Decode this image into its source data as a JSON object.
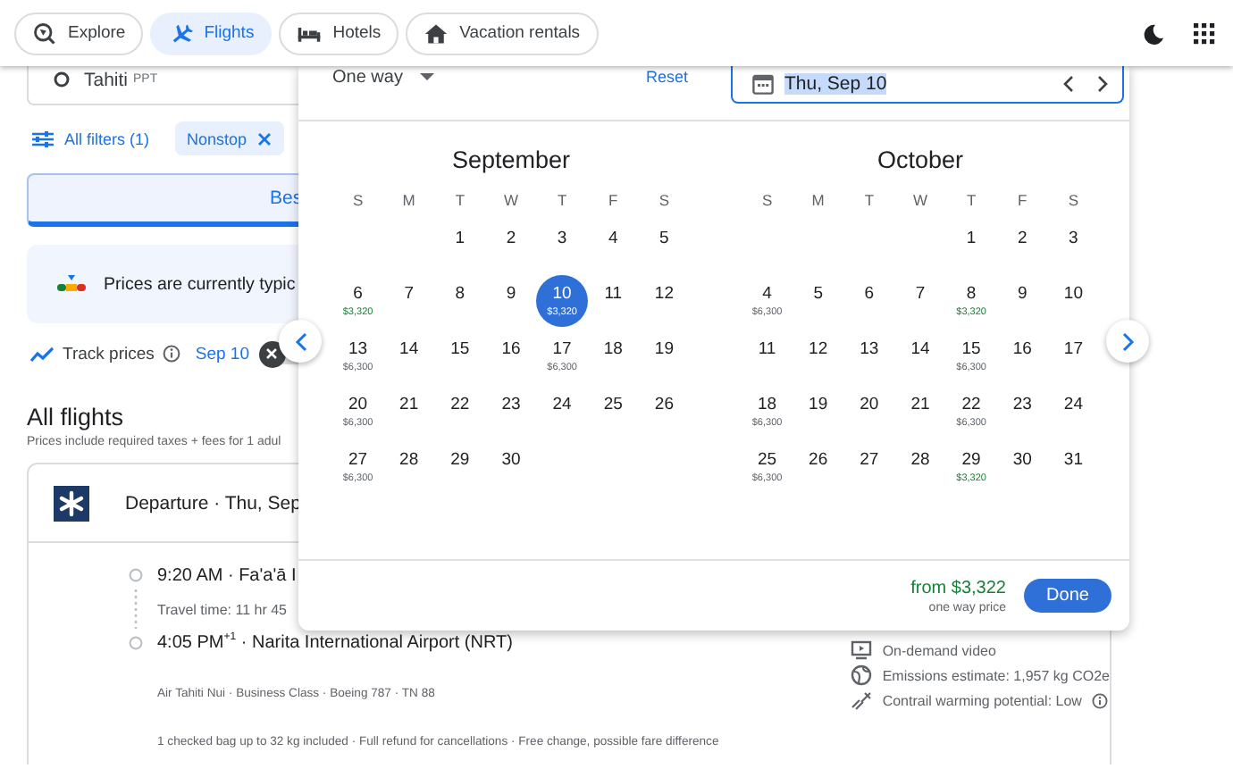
{
  "nav_chips": [
    {
      "label": "Explore",
      "kind": "explore",
      "selected": false
    },
    {
      "label": "Flights",
      "kind": "flights",
      "selected": true
    },
    {
      "label": "Hotels",
      "kind": "hotels",
      "selected": false
    },
    {
      "label": "Vacation rentals",
      "kind": "rentals",
      "selected": false
    }
  ],
  "search": {
    "origin": "Tahiti",
    "origin_code": "PPT"
  },
  "filters": {
    "all_filters": "All filters (1)",
    "chips": [
      {
        "label": "Nonstop"
      }
    ]
  },
  "sort_tab": {
    "label": "Bes",
    "selected": true
  },
  "price_insight": "Prices are currently typic",
  "track": {
    "label": "Track prices",
    "date": "Sep 10",
    "on": false
  },
  "all_flights": {
    "title": "All flights",
    "subtitle": "Prices include required taxes + fees for 1 adul"
  },
  "flight": {
    "header": "Departure · Thu, Sep",
    "departure": {
      "text": "9:20 AM · Fa'a'ā I"
    },
    "travel_time": "Travel time: 11 hr 45",
    "arrival": {
      "text": "4:05 PM$^{+1}$ · Narita International Airport (NRT)"
    },
    "details": "Air Tahiti Nui · Business Class · Boeing 787 · TN 88",
    "fare_notes": "1 checked bag up to 32 kg included · Full refund for cancellations · Free change, possible fare difference",
    "amenities": [
      {
        "kind": "video",
        "text": "On-demand video"
      },
      {
        "kind": "emissions",
        "text": "Emissions estimate: 1,957 kg CO2e"
      },
      {
        "kind": "contrail",
        "text": "Contrail warming potential: Low"
      }
    ]
  },
  "date_picker": {
    "trip_type": "One way",
    "reset": "Reset",
    "date_value": "Thu, Sep 10",
    "total": "from $3,322",
    "total_note": "one way price",
    "done": "Done",
    "months": [
      {
        "name": "September",
        "weekdays": [
          "S",
          "M",
          "T",
          "W",
          "T",
          "F",
          "S"
        ],
        "weeks": [
          [
            {
              "kind": "blank"
            },
            {
              "kind": "blank"
            },
            {
              "kind": "day",
              "day": "1",
              "selected": false
            },
            {
              "kind": "day",
              "day": "2",
              "selected": false
            },
            {
              "kind": "day",
              "day": "3",
              "selected": false
            },
            {
              "kind": "day",
              "day": "4",
              "selected": false
            },
            {
              "kind": "day",
              "day": "5",
              "selected": false
            }
          ],
          [
            {
              "kind": "day",
              "day": "6",
              "price": "$3,320",
              "cheap": true,
              "selected": false
            },
            {
              "kind": "day",
              "day": "7",
              "selected": false
            },
            {
              "kind": "day",
              "day": "8",
              "selected": false
            },
            {
              "kind": "day",
              "day": "9",
              "selected": false
            },
            {
              "kind": "day",
              "day": "10",
              "price": "$3,320",
              "cheap": true,
              "selected": true
            },
            {
              "kind": "day",
              "day": "11",
              "selected": false
            },
            {
              "kind": "day",
              "day": "12",
              "selected": false
            }
          ],
          [
            {
              "kind": "day",
              "day": "13",
              "price": "$6,300",
              "cheap": false,
              "selected": false
            },
            {
              "kind": "day",
              "day": "14",
              "selected": false
            },
            {
              "kind": "day",
              "day": "15",
              "selected": false
            },
            {
              "kind": "day",
              "day": "16",
              "selected": false
            },
            {
              "kind": "day",
              "day": "17",
              "price": "$6,300",
              "cheap": false,
              "selected": false
            },
            {
              "kind": "day",
              "day": "18",
              "selected": false
            },
            {
              "kind": "day",
              "day": "19",
              "selected": false
            }
          ],
          [
            {
              "kind": "day",
              "day": "20",
              "price": "$6,300",
              "cheap": false,
              "selected": false
            },
            {
              "kind": "day",
              "day": "21",
              "selected": false
            },
            {
              "kind": "day",
              "day": "22",
              "selected": false
            },
            {
              "kind": "day",
              "day": "23",
              "selected": false
            },
            {
              "kind": "day",
              "day": "24",
              "selected": false
            },
            {
              "kind": "day",
              "day": "25",
              "selected": false
            },
            {
              "kind": "day",
              "day": "26",
              "selected": false
            }
          ],
          [
            {
              "kind": "day",
              "day": "27",
              "price": "$6,300",
              "cheap": false,
              "selected": false
            },
            {
              "kind": "day",
              "day": "28",
              "selected": false
            },
            {
              "kind": "day",
              "day": "29",
              "selected": false
            },
            {
              "kind": "day",
              "day": "30",
              "selected": false
            }
          ]
        ]
      },
      {
        "name": "October",
        "weekdays": [
          "S",
          "M",
          "T",
          "W",
          "T",
          "F",
          "S"
        ],
        "weeks": [
          [
            {
              "kind": "blank"
            },
            {
              "kind": "blank"
            },
            {
              "kind": "blank"
            },
            {
              "kind": "blank"
            },
            {
              "kind": "day",
              "day": "1",
              "selected": false
            },
            {
              "kind": "day",
              "day": "2",
              "selected": false
            },
            {
              "kind": "day",
              "day": "3",
              "selected": false
            }
          ],
          [
            {
              "kind": "day",
              "day": "4",
              "price": "$6,300",
              "cheap": false,
              "selected": false
            },
            {
              "kind": "day",
              "day": "5",
              "selected": false
            },
            {
              "kind": "day",
              "day": "6",
              "selected": false
            },
            {
              "kind": "day",
              "day": "7",
              "selected": false
            },
            {
              "kind": "day",
              "day": "8",
              "price": "$3,320",
              "cheap": true,
              "selected": false
            },
            {
              "kind": "day",
              "day": "9",
              "selected": false
            },
            {
              "kind": "day",
              "day": "10",
              "selected": false
            }
          ],
          [
            {
              "kind": "day",
              "day": "11",
              "selected": false
            },
            {
              "kind": "day",
              "day": "12",
              "selected": false
            },
            {
              "kind": "day",
              "day": "13",
              "selected": false
            },
            {
              "kind": "day",
              "day": "14",
              "selected": false
            },
            {
              "kind": "day",
              "day": "15",
              "price": "$6,300",
              "cheap": false,
              "selected": false
            },
            {
              "kind": "day",
              "day": "16",
              "selected": false
            },
            {
              "kind": "day",
              "day": "17",
              "selected": false
            }
          ],
          [
            {
              "kind": "day",
              "day": "18",
              "price": "$6,300",
              "cheap": false,
              "selected": false
            },
            {
              "kind": "day",
              "day": "19",
              "selected": false
            },
            {
              "kind": "day",
              "day": "20",
              "selected": false
            },
            {
              "kind": "day",
              "day": "21",
              "selected": false
            },
            {
              "kind": "day",
              "day": "22",
              "price": "$6,300",
              "cheap": false,
              "selected": false
            },
            {
              "kind": "day",
              "day": "23",
              "selected": false
            },
            {
              "kind": "day",
              "day": "24",
              "selected": false
            }
          ],
          [
            {
              "kind": "day",
              "day": "25",
              "price": "$6,300",
              "cheap": false,
              "selected": false
            },
            {
              "kind": "day",
              "day": "26",
              "selected": false
            },
            {
              "kind": "day",
              "day": "27",
              "selected": false
            },
            {
              "kind": "day",
              "day": "28",
              "selected": false
            },
            {
              "kind": "day",
              "day": "29",
              "price": "$3,320",
              "cheap": true,
              "selected": false
            },
            {
              "kind": "day",
              "day": "30",
              "selected": false
            },
            {
              "kind": "day",
              "day": "31",
              "selected": false
            }
          ]
        ]
      }
    ]
  }
}
